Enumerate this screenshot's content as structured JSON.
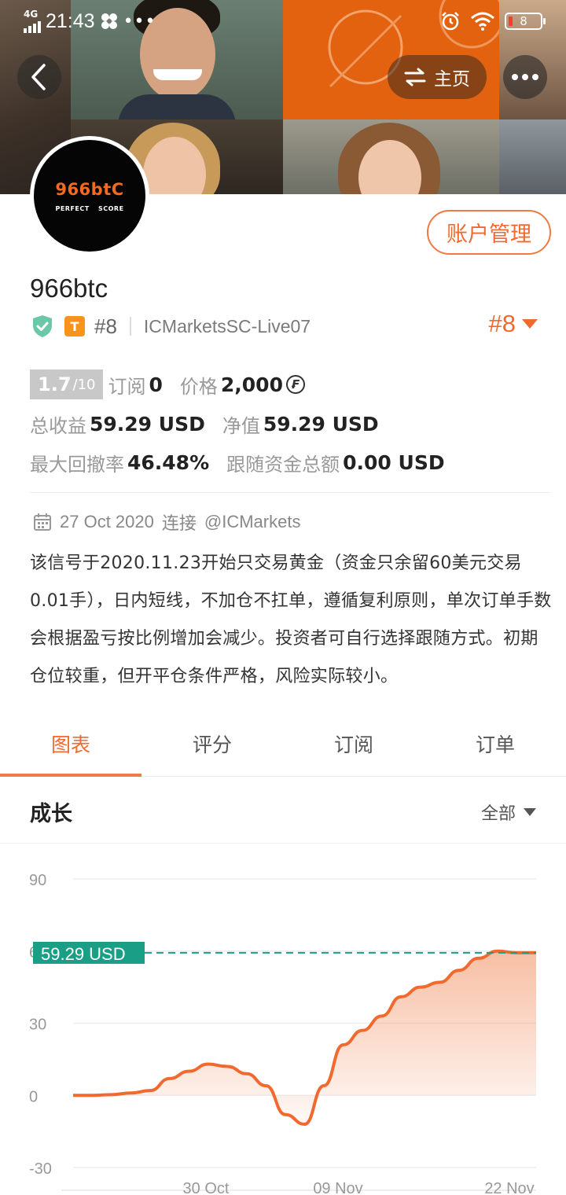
{
  "status_bar": {
    "network": "4G",
    "time": "21:43",
    "battery": "8"
  },
  "header": {
    "home_label": "主页"
  },
  "profile": {
    "logo_text": "966btC",
    "logo_sub": "PERFECT SCORE",
    "name": "966btc",
    "manage_label": "账户管理",
    "tier_badge": "T",
    "rank_small": "#8",
    "server": "ICMarketsSC-Live07",
    "rank_big": "#8"
  },
  "stats": {
    "score": "1.7",
    "score_max": "/10",
    "subscribe_label": "订阅",
    "subscribe_value": "0",
    "price_label": "价格",
    "price_value": "2,000",
    "price_icon": "₣",
    "total_profit_label": "总收益",
    "total_profit_value": "59.29 USD",
    "net_value_label": "净值",
    "net_value_value": "59.29 USD",
    "max_drawdown_label": "最大回撤率",
    "max_drawdown_value": "46.48%",
    "follow_funds_label": "跟随资金总额",
    "follow_funds_value": "0.00 USD"
  },
  "signal": {
    "date": "27 Oct 2020",
    "connect_label": "连接",
    "broker": "@ICMarkets",
    "description": "该信号于2020.11.23开始只交易黄金（资金只余留60美元交易0.01手），日内短线，不加仓不扛单，遵循复利原则，单次订单手数会根据盈亏按比例增加会减少。投资者可自行选择跟随方式。初期仓位较重，但开平仓条件严格，风险实际较小。"
  },
  "tabs": [
    {
      "label": "图表",
      "active": true
    },
    {
      "label": "评分",
      "active": false
    },
    {
      "label": "订阅",
      "active": false
    },
    {
      "label": "订单",
      "active": false
    }
  ],
  "section": {
    "title": "成长",
    "range_label": "全部"
  },
  "colors": {
    "accent": "#f06a30",
    "current_value_tag": "#1a9e86"
  },
  "chart_data": {
    "type": "area",
    "title": "成长",
    "ylim": [
      -30,
      90
    ],
    "y_ticks": [
      "90",
      "60",
      "30",
      "0",
      "-30"
    ],
    "x_ticks": [
      "30 Oct",
      "09 Nov",
      "22 Nov"
    ],
    "current_value_label": "59.29 USD",
    "current_value": 59.29,
    "series": [
      {
        "values": [
          0,
          0,
          0.3,
          1,
          2,
          7,
          10,
          13,
          12,
          9,
          4,
          -8,
          -12,
          4,
          21,
          27,
          33,
          41,
          45,
          47,
          52,
          57,
          60,
          59.29,
          59.29
        ]
      }
    ],
    "grid": true
  }
}
